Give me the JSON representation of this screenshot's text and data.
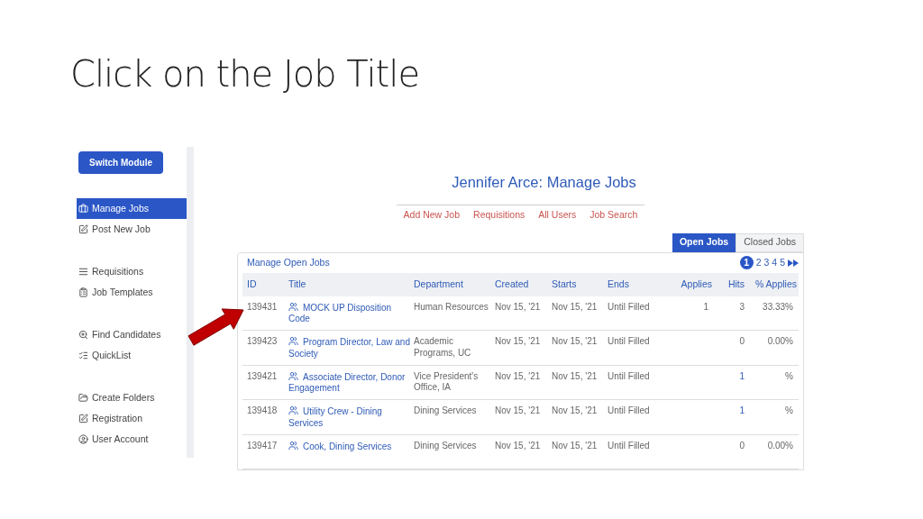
{
  "slide_title": "Click on the Job Title",
  "sidebar": {
    "button": "Switch Module",
    "groups": [
      {
        "items": [
          {
            "label": "Manage Jobs",
            "selected": true
          },
          {
            "label": "Post New Job",
            "selected": false
          }
        ]
      },
      {
        "items": [
          {
            "label": "Requisitions",
            "selected": false
          },
          {
            "label": "Job Templates",
            "selected": false
          }
        ]
      },
      {
        "items": [
          {
            "label": "Find Candidates",
            "selected": false
          },
          {
            "label": "QuickList",
            "selected": false
          }
        ]
      },
      {
        "items": [
          {
            "label": "Create Folders",
            "selected": false
          },
          {
            "label": "Registration",
            "selected": false
          },
          {
            "label": "User Account",
            "selected": false
          }
        ]
      }
    ]
  },
  "header": {
    "title": "Jennifer Arce: Manage Jobs",
    "links": [
      "Add New Job",
      "Requisitions",
      "All Users",
      "Job Search"
    ]
  },
  "tabs": [
    {
      "label": "Open Jobs",
      "selected": true
    },
    {
      "label": "Closed Jobs",
      "selected": false
    }
  ],
  "panel": {
    "title": "Manage Open Jobs",
    "pages": [
      {
        "label": "1",
        "selected": true
      },
      {
        "label": "2",
        "selected": false
      },
      {
        "label": "3",
        "selected": false
      },
      {
        "label": "4",
        "selected": false
      },
      {
        "label": "5",
        "selected": false
      }
    ],
    "columns": [
      "ID",
      "Title",
      "Department",
      "Created",
      "Starts",
      "Ends",
      "Applies",
      "Hits",
      "% Applies"
    ],
    "rows": [
      {
        "id": "139431",
        "title": "MOCK UP Disposition Code",
        "department": "Human Resources",
        "created": "Nov 15, '21",
        "starts": "Nov 15, '21",
        "ends": "Until Filled",
        "applies": "1",
        "hits": "3",
        "hits_link": false,
        "percent": "33.33%"
      },
      {
        "id": "139423",
        "title": "Program Director, Law and Society",
        "department": "Academic Programs, UC",
        "created": "Nov 15, '21",
        "starts": "Nov 15, '21",
        "ends": "Until Filled",
        "hits": "0",
        "hits_link": false,
        "percent": "0.00%"
      },
      {
        "id": "139421",
        "title": "Associate Director, Donor Engagement",
        "department": "Vice President's Office, IA",
        "created": "Nov 15, '21",
        "starts": "Nov 15, '21",
        "ends": "Until Filled",
        "hits": "1",
        "hits_link": true,
        "percent": "%"
      },
      {
        "id": "139418",
        "title": "Utility Crew - Dining Services",
        "department": "Dining Services",
        "created": "Nov 15, '21",
        "starts": "Nov 15, '21",
        "ends": "Until Filled",
        "hits": "1",
        "hits_link": true,
        "percent": "%"
      },
      {
        "id": "139417",
        "title": "Cook, Dining Services",
        "department": "Dining Services",
        "created": "Nov 15, '21",
        "starts": "Nov 15, '21",
        "ends": "Until Filled",
        "hits": "0",
        "hits_link": false,
        "percent": "0.00%"
      }
    ]
  }
}
